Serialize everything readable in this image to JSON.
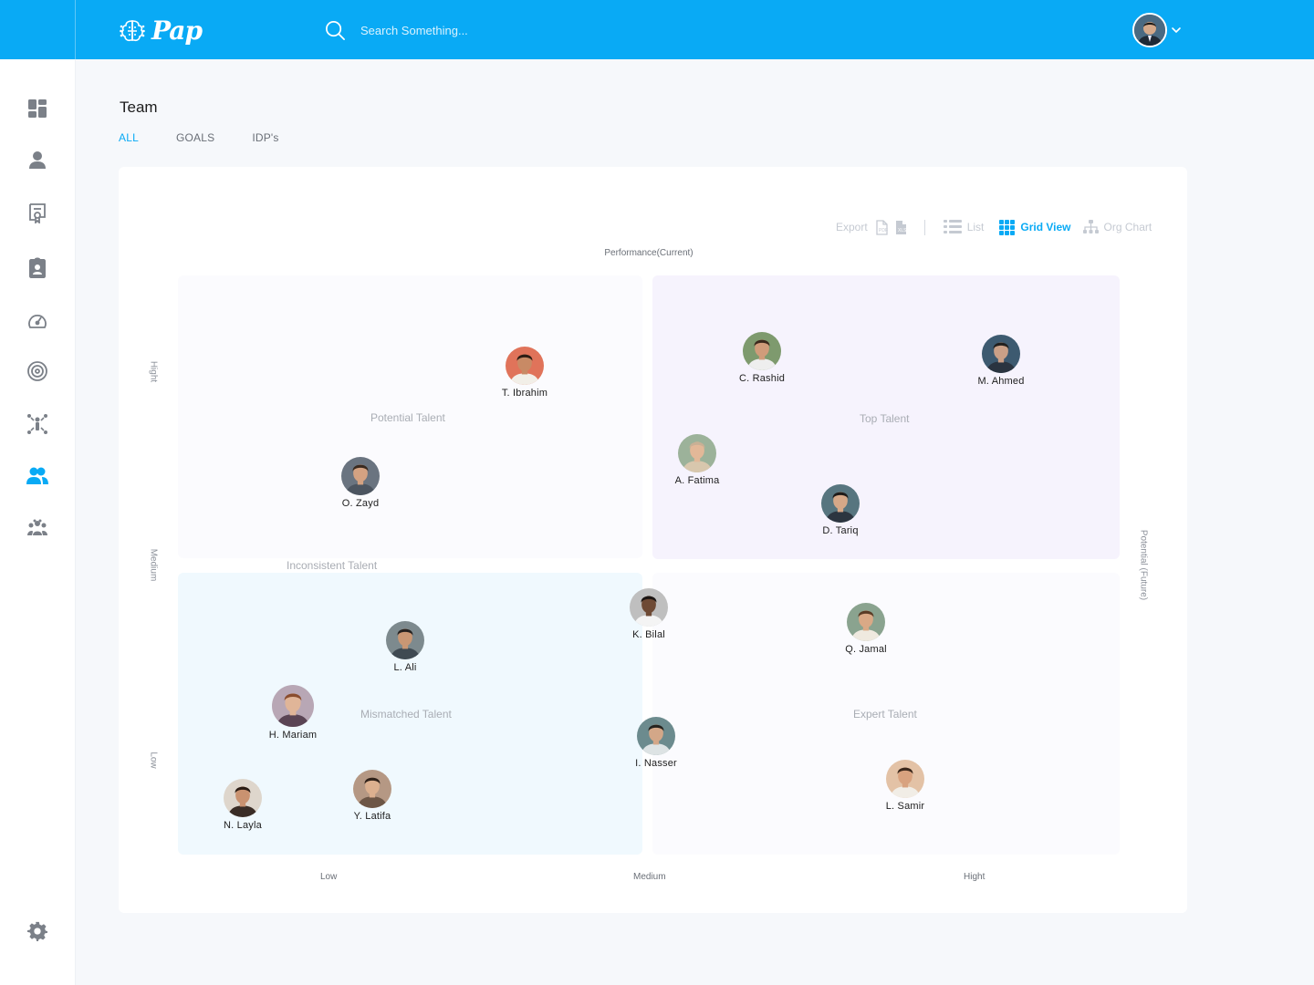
{
  "app": {
    "name": "Pap"
  },
  "search": {
    "placeholder": "Search Something..."
  },
  "page": {
    "title": "Team"
  },
  "tabs": [
    {
      "label": "ALL",
      "active": true
    },
    {
      "label": "GOALS",
      "active": false
    },
    {
      "label": "IDP's",
      "active": false
    }
  ],
  "sidebar": {
    "items": [
      {
        "icon": "dashboard-icon",
        "active": false
      },
      {
        "icon": "profile-icon",
        "active": false
      },
      {
        "icon": "certificate-icon",
        "active": false
      },
      {
        "icon": "clipboard-icon",
        "active": false
      },
      {
        "icon": "speedometer-icon",
        "active": false
      },
      {
        "icon": "target-icon",
        "active": false
      },
      {
        "icon": "org-network-icon",
        "active": false
      },
      {
        "icon": "team-icon",
        "active": true
      },
      {
        "icon": "people-group-icon",
        "active": false
      }
    ],
    "settings_icon": "gear-icon"
  },
  "toolbar": {
    "export_label": "Export",
    "list_label": "List",
    "grid_label": "Grid View",
    "org_label": "Org Chart",
    "active_view": "Grid View"
  },
  "grid": {
    "top_axis": "Performance(Current)",
    "right_axis": "Potential (Future)",
    "left_ticks": [
      "Hight",
      "Medium",
      "Low"
    ],
    "bottom_ticks": [
      "Low",
      "Medium",
      "Hight"
    ],
    "quadrants": {
      "potential": "Potential Talent",
      "top": "Top Talent",
      "inconsistent": "Inconsistent Talent",
      "mismatched": "Mismatched Talent",
      "expert": "Expert Talent"
    },
    "people": [
      {
        "name": "T. Ibrahim",
        "skin": "#c88a65",
        "hair": "#2d1d14",
        "bg": "#e0735a",
        "shirt": "#f2efe8"
      },
      {
        "name": "O. Zayd",
        "skin": "#d4a282",
        "hair": "#3a2a1f",
        "bg": "#6a7480",
        "shirt": "#4c5560"
      },
      {
        "name": "C. Rashid",
        "skin": "#d09c7a",
        "hair": "#3b2a1d",
        "bg": "#7e9a6e",
        "shirt": "#eeeeee"
      },
      {
        "name": "M. Ahmed",
        "skin": "#caa087",
        "hair": "#22201e",
        "bg": "#3d5a70",
        "shirt": "#2a3440"
      },
      {
        "name": "A. Fatima",
        "skin": "#e2b898",
        "hair": "#c8b095",
        "bg": "#9cb29a",
        "shirt": "#d8c7ad"
      },
      {
        "name": "D. Tariq",
        "skin": "#d6a888",
        "hair": "#1f1b19",
        "bg": "#57757f",
        "shirt": "#2c3540"
      },
      {
        "name": "K. Bilal",
        "skin": "#6e4a35",
        "hair": "#1b1512",
        "bg": "#bfbfbf",
        "shirt": "#f4f4f4"
      },
      {
        "name": "L. Ali",
        "skin": "#c99774",
        "hair": "#262220",
        "bg": "#7d8a8e",
        "shirt": "#3f4a52"
      },
      {
        "name": "Q. Jamal",
        "skin": "#d9a986",
        "hair": "#5a3c26",
        "bg": "#8aa38f",
        "shirt": "#efe9df"
      },
      {
        "name": "H. Mariam",
        "skin": "#e0b598",
        "hair": "#8a4d2e",
        "bg": "#b8a7b5",
        "shirt": "#5a4454"
      },
      {
        "name": "I. Nasser",
        "skin": "#d3a788",
        "hair": "#25231f",
        "bg": "#6c8b8e",
        "shirt": "#dde3e4"
      },
      {
        "name": "Y. Latifa",
        "skin": "#dcb08f",
        "hair": "#2f2119",
        "bg": "#b59884",
        "shirt": "#6d5646"
      },
      {
        "name": "N. Layla",
        "skin": "#c99270",
        "hair": "#2a1c14",
        "bg": "#ded6cc",
        "shirt": "#3a2d26"
      },
      {
        "name": "L. Samir",
        "skin": "#d8a27f",
        "hair": "#3a271b",
        "bg": "#e3c2a6",
        "shirt": "#f1ede6"
      }
    ]
  },
  "colors": {
    "brand": "#09aaf5",
    "quadrant_potential": "#fbfbfe",
    "quadrant_top": "#f6f3fd",
    "quadrant_mismatched": "#f0f9fe",
    "quadrant_expert": "#fbfbfe"
  }
}
